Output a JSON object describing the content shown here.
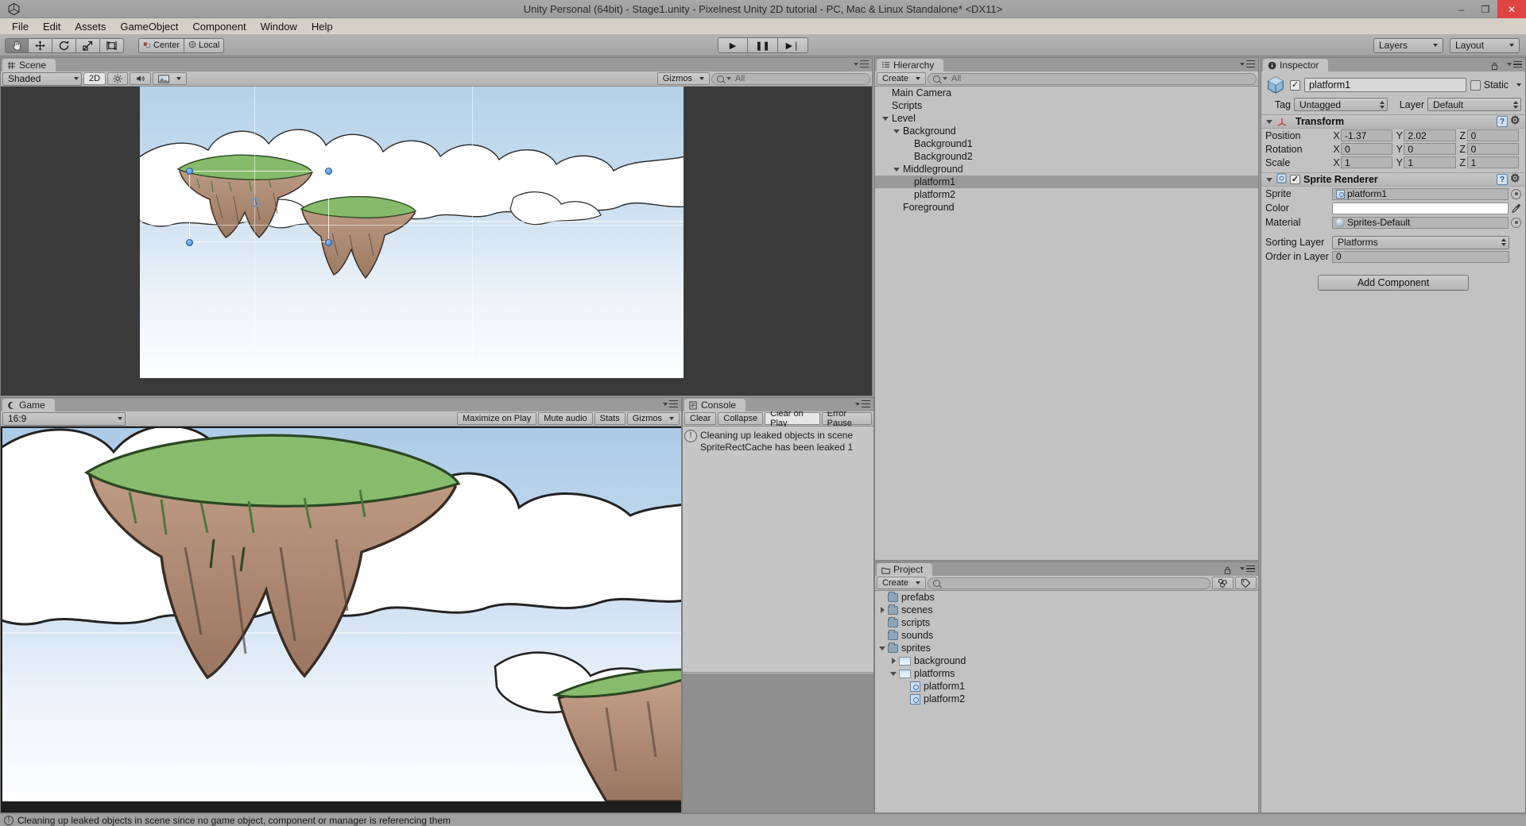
{
  "window": {
    "title": "Unity Personal (64bit) - Stage1.unity - Pixelnest Unity 2D tutorial - PC, Mac & Linux Standalone* <DX11>",
    "minimize": "–",
    "maximize": "❐",
    "close": "✕"
  },
  "menubar": {
    "items": [
      "File",
      "Edit",
      "Assets",
      "GameObject",
      "Component",
      "Window",
      "Help"
    ]
  },
  "toolbar": {
    "transform_tools": [
      {
        "name": "hand-tool",
        "glyph": "✋",
        "active": true
      },
      {
        "name": "move-tool",
        "glyph": "✥",
        "active": false
      },
      {
        "name": "rotate-tool",
        "glyph": "↻",
        "active": false
      },
      {
        "name": "scale-tool",
        "glyph": "⤡",
        "active": false
      },
      {
        "name": "rect-tool",
        "glyph": "⌗",
        "active": false
      }
    ],
    "pivot_mode": "Center",
    "pivot_rotation": "Local",
    "play": "▶",
    "pause": "❚❚",
    "step": "▶❘",
    "layers": "Layers",
    "layout": "Layout"
  },
  "scene": {
    "tab": "Scene",
    "draw_mode": "Shaded",
    "mode_2d": "2D",
    "lighting": "☀",
    "audio": "ὐA",
    "effects": "⛰",
    "gizmos": "Gizmos",
    "search_placeholder": "All"
  },
  "game": {
    "tab": "Game",
    "aspect": "16:9",
    "maximize_on_play": "Maximize on Play",
    "mute_audio": "Mute audio",
    "stats": "Stats",
    "gizmos": "Gizmos"
  },
  "console": {
    "tab": "Console",
    "clear": "Clear",
    "collapse": "Collapse",
    "clear_on_play": "Clear on Play",
    "error_pause": "Error Pause",
    "messages": [
      {
        "line1": "Cleaning up leaked objects in scene",
        "line2": "SpriteRectCache has been leaked 1"
      }
    ]
  },
  "hierarchy": {
    "tab": "Hierarchy",
    "create": "Create",
    "search_placeholder": "All",
    "items": [
      {
        "label": "Main Camera",
        "depth": 0,
        "toggle": "none",
        "selected": false
      },
      {
        "label": "Scripts",
        "depth": 0,
        "toggle": "none",
        "selected": false
      },
      {
        "label": "Level",
        "depth": 0,
        "toggle": "down",
        "selected": false
      },
      {
        "label": "Background",
        "depth": 1,
        "toggle": "down",
        "selected": false
      },
      {
        "label": "Background1",
        "depth": 2,
        "toggle": "none",
        "selected": false
      },
      {
        "label": "Background2",
        "depth": 2,
        "toggle": "none",
        "selected": false
      },
      {
        "label": "Middleground",
        "depth": 1,
        "toggle": "down",
        "selected": false
      },
      {
        "label": "platform1",
        "depth": 2,
        "toggle": "none",
        "selected": true
      },
      {
        "label": "platform2",
        "depth": 2,
        "toggle": "none",
        "selected": false
      },
      {
        "label": "Foreground",
        "depth": 1,
        "toggle": "none",
        "selected": false
      }
    ]
  },
  "project": {
    "tab": "Project",
    "create": "Create",
    "search_placeholder": "",
    "items": [
      {
        "label": "prefabs",
        "depth": 0,
        "toggle": "none",
        "icon": "folder"
      },
      {
        "label": "scenes",
        "depth": 0,
        "toggle": "right",
        "icon": "folder"
      },
      {
        "label": "scripts",
        "depth": 0,
        "toggle": "none",
        "icon": "folder"
      },
      {
        "label": "sounds",
        "depth": 0,
        "toggle": "none",
        "icon": "folder"
      },
      {
        "label": "sprites",
        "depth": 0,
        "toggle": "down",
        "icon": "folder"
      },
      {
        "label": "background",
        "depth": 1,
        "toggle": "right",
        "icon": "image"
      },
      {
        "label": "platforms",
        "depth": 1,
        "toggle": "down",
        "icon": "image"
      },
      {
        "label": "platform1",
        "depth": 2,
        "toggle": "none",
        "icon": "sprite"
      },
      {
        "label": "platform2",
        "depth": 2,
        "toggle": "none",
        "icon": "sprite"
      }
    ]
  },
  "inspector": {
    "tab": "Inspector",
    "object_name": "platform1",
    "enabled": true,
    "static_label": "Static",
    "tag_label": "Tag",
    "tag_value": "Untagged",
    "layer_label": "Layer",
    "layer_value": "Default",
    "transform": {
      "title": "Transform",
      "rows": [
        {
          "label": "Position",
          "x": "-1.37",
          "y": "2.02",
          "z": "0"
        },
        {
          "label": "Rotation",
          "x": "0",
          "y": "0",
          "z": "0"
        },
        {
          "label": "Scale",
          "x": "1",
          "y": "1",
          "z": "1"
        }
      ]
    },
    "sprite_renderer": {
      "title": "Sprite Renderer",
      "enabled": true,
      "sprite_label": "Sprite",
      "sprite_value": "platform1",
      "color_label": "Color",
      "color_value": "#ffffff",
      "material_label": "Material",
      "material_value": "Sprites-Default",
      "sorting_layer_label": "Sorting Layer",
      "sorting_layer_value": "Platforms",
      "order_in_layer_label": "Order in Layer",
      "order_in_layer_value": "0"
    },
    "add_component": "Add Component"
  },
  "statusbar": {
    "message": "Cleaning up leaked objects in scene since no game object, component or manager is referencing them"
  },
  "colors": {
    "chrome": "#c2c2c2",
    "chrome_dark": "#9a9a9a",
    "selection_blue": "#2f7fd4",
    "sky_top": "#b7d3ea",
    "grass": "#8fbf72",
    "rock": "#b08a73"
  }
}
